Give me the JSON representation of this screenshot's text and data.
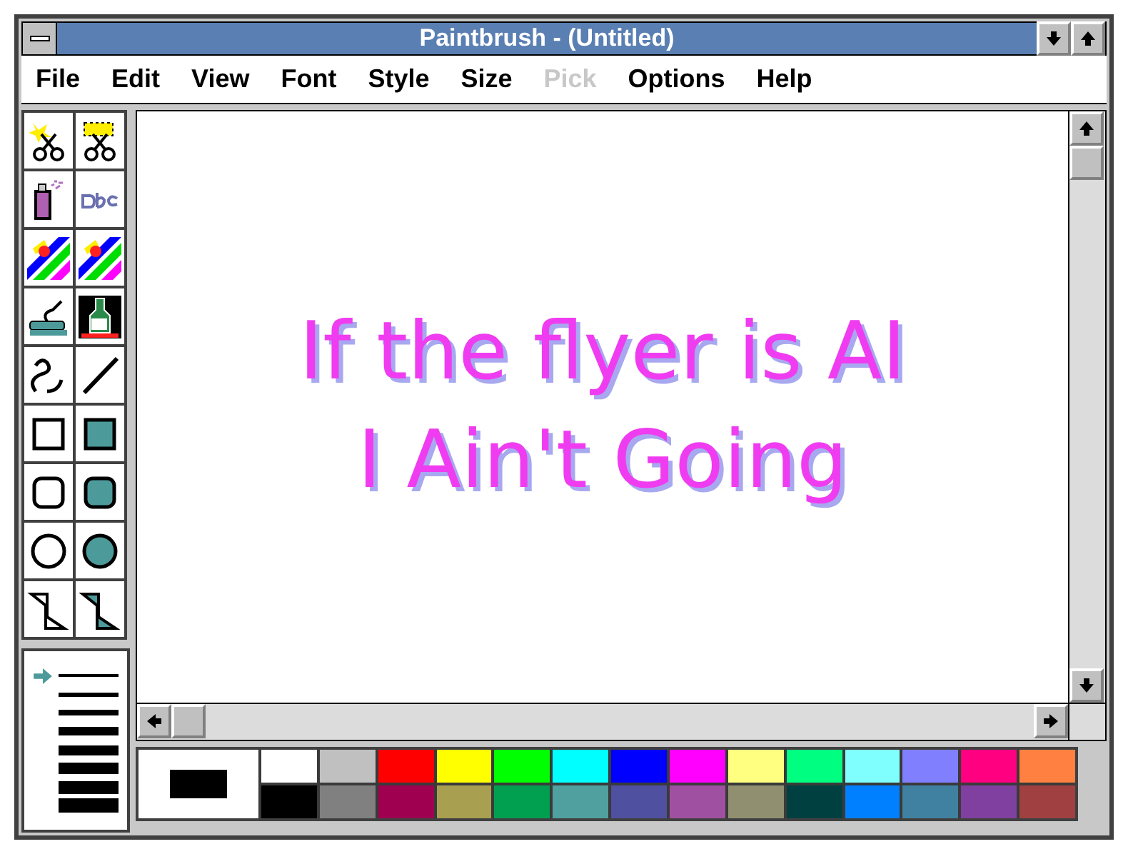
{
  "window": {
    "title": "Paintbrush - (Untitled)"
  },
  "menu": [
    {
      "label": "File",
      "disabled": false
    },
    {
      "label": "Edit",
      "disabled": false
    },
    {
      "label": "View",
      "disabled": false
    },
    {
      "label": "Font",
      "disabled": false
    },
    {
      "label": "Style",
      "disabled": false
    },
    {
      "label": "Size",
      "disabled": false
    },
    {
      "label": "Pick",
      "disabled": true
    },
    {
      "label": "Options",
      "disabled": false
    },
    {
      "label": "Help",
      "disabled": false
    }
  ],
  "tools": [
    {
      "kind": "scissors-star"
    },
    {
      "kind": "scissors-rect"
    },
    {
      "kind": "spray"
    },
    {
      "kind": "text"
    },
    {
      "kind": "eraser-color"
    },
    {
      "kind": "eraser"
    },
    {
      "kind": "roller"
    },
    {
      "kind": "bottle"
    },
    {
      "kind": "curve"
    },
    {
      "kind": "line"
    },
    {
      "kind": "rect"
    },
    {
      "kind": "rect-filled"
    },
    {
      "kind": "rounded"
    },
    {
      "kind": "rounded-filled"
    },
    {
      "kind": "ellipse"
    },
    {
      "kind": "ellipse-filled"
    },
    {
      "kind": "polygon"
    },
    {
      "kind": "polygon-filled"
    }
  ],
  "line_sizes": [
    {
      "selected": true
    },
    {
      "selected": false
    },
    {
      "selected": false
    },
    {
      "selected": false
    },
    {
      "selected": false
    },
    {
      "selected": false
    },
    {
      "selected": false
    },
    {
      "selected": false
    }
  ],
  "canvas": {
    "lines": [
      "If the flyer is AI",
      "I Ain't Going"
    ]
  },
  "current_colors": [
    {
      "kind": "background",
      "color": "#ffffff"
    },
    {
      "kind": "foreground",
      "color": "#000000"
    }
  ],
  "palette": [
    {
      "color": "#ffffff"
    },
    {
      "color": "#c0c0c0"
    },
    {
      "color": "#ff0000"
    },
    {
      "color": "#ffff00"
    },
    {
      "color": "#00ff00"
    },
    {
      "color": "#00ffff"
    },
    {
      "color": "#0000ff"
    },
    {
      "color": "#ff00ff"
    },
    {
      "color": "#ffff80"
    },
    {
      "color": "#00ff80"
    },
    {
      "color": "#80ffff"
    },
    {
      "color": "#8080ff"
    },
    {
      "color": "#ff0080"
    },
    {
      "color": "#ff8040"
    },
    {
      "color": "#000000"
    },
    {
      "color": "#808080"
    },
    {
      "color": "#a00050"
    },
    {
      "color": "#a8a050"
    },
    {
      "color": "#00a050"
    },
    {
      "color": "#50a0a0"
    },
    {
      "color": "#5050a0"
    },
    {
      "color": "#a050a0"
    },
    {
      "color": "#909070"
    },
    {
      "color": "#004040"
    },
    {
      "color": "#0080ff"
    },
    {
      "color": "#4080a0"
    },
    {
      "color": "#8040a0"
    },
    {
      "color": "#a04040"
    }
  ]
}
